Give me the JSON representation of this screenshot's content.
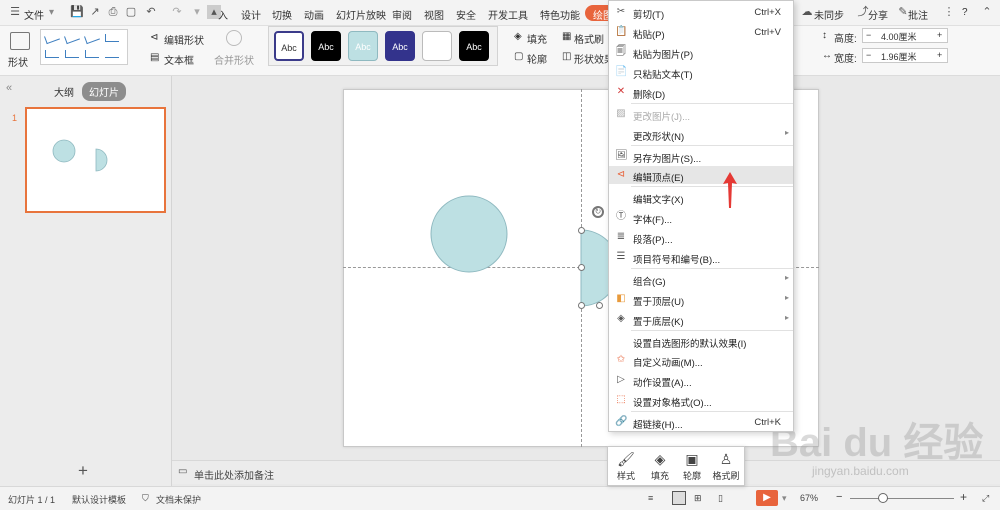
{
  "menubar": {
    "file": "文件",
    "tabs": [
      "入",
      "设计",
      "切换",
      "动画",
      "幻灯片放映",
      "审阅",
      "视图",
      "安全",
      "开发工具",
      "特色功能"
    ],
    "active_tab": "绘图",
    "sync": "未同步",
    "share": "分享",
    "comment": "批注",
    "help": "?"
  },
  "ribbon": {
    "shape": "形状",
    "edit_shape": "编辑形状",
    "textbox": "文本框",
    "merge_shape": "合并形状",
    "style_label": "Abc",
    "fill": "填充",
    "outline": "轮廓",
    "format_brush": "格式刷",
    "shape_effect": "形状效果",
    "height_label": "高度:",
    "height_value": "4.00厘米",
    "width_label": "宽度:",
    "width_value": "1.96厘米"
  },
  "leftpanel": {
    "outline_tab": "大纲",
    "slides_tab": "幻灯片",
    "slide_number": "1",
    "add": "+"
  },
  "notes": {
    "placeholder": "单击此处添加备注"
  },
  "statusbar": {
    "slide_info": "幻灯片 1 / 1",
    "template": "默认设计模板",
    "protect": "文档未保护",
    "zoom": "67%",
    "minus": "−",
    "plus": "+"
  },
  "context_menu": [
    {
      "label": "剪切(T)",
      "shortcut": "Ctrl+X",
      "icon": "scissors-icon"
    },
    {
      "label": "粘贴(P)",
      "shortcut": "Ctrl+V",
      "icon": "paste-icon"
    },
    {
      "label": "粘贴为图片(P)",
      "icon": "paste-image-icon"
    },
    {
      "label": "只粘贴文本(T)",
      "icon": "paste-text-icon"
    },
    {
      "label": "删除(D)",
      "icon": "delete-icon"
    },
    {
      "label": "更改图片(J)...",
      "disabled": true,
      "icon": "change-image-icon"
    },
    {
      "label": "更改形状(N)",
      "submenu": true
    },
    {
      "label": "另存为图片(S)...",
      "icon": "save-image-icon"
    },
    {
      "label": "编辑顶点(E)",
      "highlight": true,
      "icon": "edit-points-icon"
    },
    {
      "label": "编辑文字(X)"
    },
    {
      "label": "字体(F)...",
      "icon": "font-icon"
    },
    {
      "label": "段落(P)...",
      "icon": "paragraph-icon"
    },
    {
      "label": "项目符号和编号(B)...",
      "icon": "bullets-icon"
    },
    {
      "label": "组合(G)",
      "submenu": true
    },
    {
      "label": "置于顶层(U)",
      "submenu": true,
      "icon": "bring-front-icon"
    },
    {
      "label": "置于底层(K)",
      "submenu": true,
      "icon": "send-back-icon"
    },
    {
      "label": "设置自选图形的默认效果(I)"
    },
    {
      "label": "自定义动画(M)...",
      "icon": "animation-icon"
    },
    {
      "label": "动作设置(A)...",
      "icon": "action-icon"
    },
    {
      "label": "设置对象格式(O)...",
      "icon": "format-object-icon"
    },
    {
      "label": "超链接(H)...",
      "shortcut": "Ctrl+K",
      "icon": "hyperlink-icon"
    }
  ],
  "minibar": {
    "style": "样式",
    "fill": "填充",
    "outline": "轮廓",
    "format_brush": "格式刷"
  },
  "watermark": {
    "brand": "Bai du 经验",
    "url": "jingyan.baidu.com"
  },
  "colors": {
    "accent": "#e8643c",
    "shape_fill": "#bde0e3",
    "arrow": "#e53935"
  }
}
